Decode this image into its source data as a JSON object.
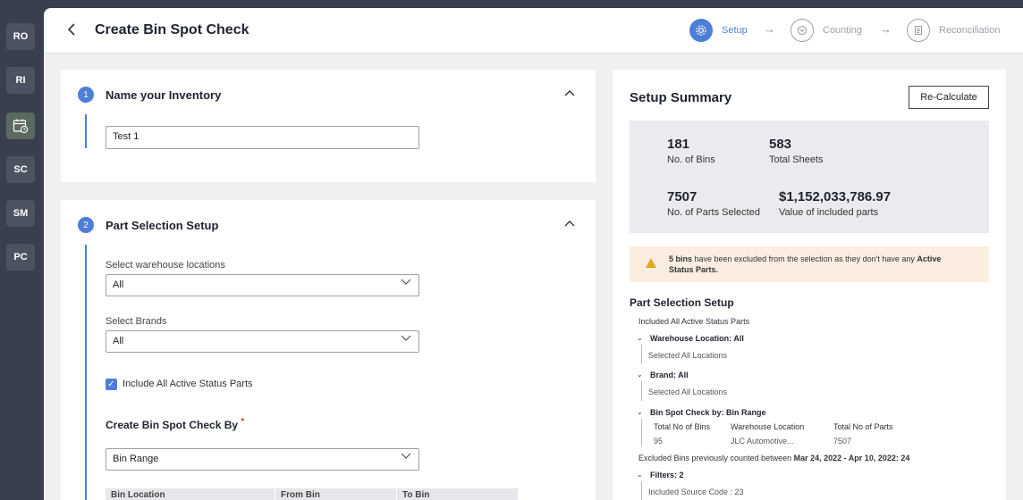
{
  "sidebar": {
    "items": [
      "RO",
      "RI",
      "",
      "SC",
      "SM",
      "PC"
    ],
    "calendar_icon": "calendar-clock-icon"
  },
  "header": {
    "title": "Create Bin Spot Check",
    "steps": [
      {
        "label": "Setup",
        "icon": "gear-icon"
      },
      {
        "label": "Counting",
        "icon": "counting-icon"
      },
      {
        "label": "Reconciliation",
        "icon": "clipboard-icon"
      }
    ]
  },
  "section1": {
    "number": "1",
    "title": "Name your Inventory",
    "name_value": "Test 1"
  },
  "section2": {
    "number": "2",
    "title": "Part Selection Setup",
    "warehouse_label": "Select warehouse locations",
    "warehouse_value": "All",
    "brands_label": "Select Brands",
    "brands_value": "All",
    "include_label": "Include All Active Status Parts",
    "include_checked": true,
    "spotcheck_label": "Create Bin Spot Check By",
    "spotcheck_required": "*",
    "spotcheck_value": "Bin Range",
    "table_headers": [
      "Bin Location",
      "From Bin",
      "To Bin"
    ]
  },
  "summary": {
    "title": "Setup Summary",
    "recalc_label": "Re-Calculate",
    "stats": [
      {
        "value": "181",
        "label": "No. of Bins"
      },
      {
        "value": "583",
        "label": "Total Sheets"
      },
      {
        "value": "7507",
        "label": "No. of Parts Selected"
      },
      {
        "value": "$1,152,033,786.97",
        "label": "Value of included parts"
      }
    ],
    "warning": {
      "bold1": "5 bins",
      "text": " have been excluded from the selection as they don't have any ",
      "bold2": "Active Status Parts."
    },
    "tree_title": "Part Selection Setup",
    "included": "Included All Active Status Parts",
    "warehouse_head": "Warehouse Location: All",
    "warehouse_sub": "Selected All Locations",
    "brand_head": "Brand: All",
    "brand_sub": "Selected All Locations",
    "binspot_head": "Bin Spot Check by: Bin Range",
    "bin_cols": [
      "Total No of Bins",
      "Warehouse Location",
      "Total No of Parts"
    ],
    "bin_vals": [
      "95",
      "JLC Automotive...",
      "7507"
    ],
    "excluded_prefix": "Excluded Bins previously counted between ",
    "excluded_range": "Mar 24, 2022  -  Apr 10, 2022: 24",
    "filters_head": "Filters: 2",
    "filters_sub": "Included Source Code : 23"
  }
}
